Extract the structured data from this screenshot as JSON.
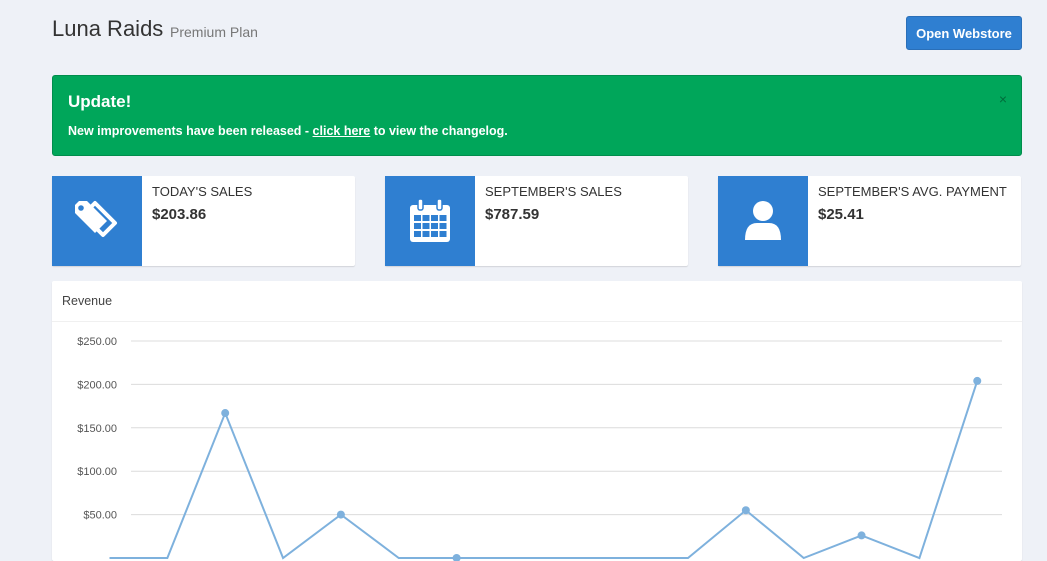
{
  "header": {
    "store_name": "Luna Raids",
    "plan": "Premium Plan",
    "open_webstore_label": "Open Webstore"
  },
  "alert": {
    "title": "Update!",
    "message_before": "New improvements have been released - ",
    "link_text": "click here",
    "message_after": " to view the changelog.",
    "close_symbol": "×"
  },
  "stats": [
    {
      "label": "TODAY'S SALES",
      "value": "$203.86",
      "icon": "tags-icon"
    },
    {
      "label": "SEPTEMBER'S SALES",
      "value": "$787.59",
      "icon": "calendar-icon"
    },
    {
      "label": "SEPTEMBER'S AVG. PAYMENT",
      "value": "$25.41",
      "icon": "user-icon"
    }
  ],
  "colors": {
    "accent": "#2f7fd1",
    "success": "#00a65a",
    "line": "#7eb1dd"
  },
  "chart_data": {
    "type": "line",
    "title": "Revenue",
    "ylim": [
      0,
      250
    ],
    "yticks": [
      {
        "value": 250,
        "label": "$250.00"
      },
      {
        "value": 200,
        "label": "$200.00"
      },
      {
        "value": 150,
        "label": "$150.00"
      },
      {
        "value": 100,
        "label": "$100.00"
      },
      {
        "value": 50,
        "label": "$50.00"
      }
    ],
    "grid": true,
    "series": [
      {
        "values": [
          0,
          0,
          167,
          0,
          50,
          0,
          0,
          0,
          0,
          0,
          0,
          55,
          0,
          26,
          0,
          204
        ],
        "markers": [
          false,
          false,
          true,
          false,
          true,
          false,
          true,
          false,
          false,
          false,
          false,
          true,
          false,
          true,
          false,
          true
        ]
      }
    ]
  }
}
